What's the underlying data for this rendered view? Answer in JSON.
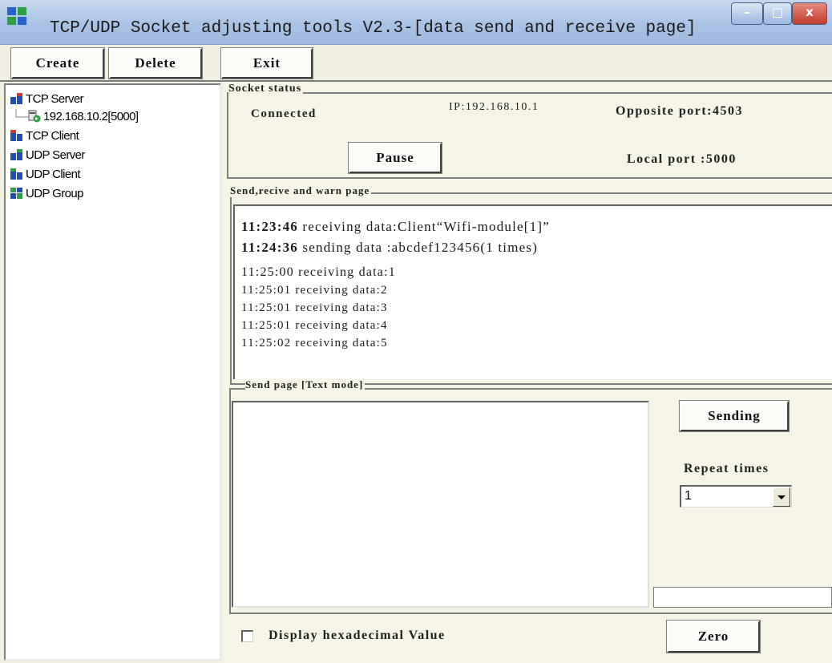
{
  "window": {
    "title": "TCP/UDP Socket adjusting tools V2.3-[data send and receive page]",
    "controls": {
      "minimize": "–",
      "maximize": "□",
      "close": "x"
    }
  },
  "toolbar": {
    "create": "Create",
    "delete": "Delete",
    "exit": "Exit"
  },
  "tree": {
    "items": [
      {
        "label": "TCP Server",
        "icon": "server-icon"
      },
      {
        "label": "192.168.10.2[5000]",
        "icon": "connection-icon"
      },
      {
        "label": "TCP Client",
        "icon": "client-icon"
      },
      {
        "label": "UDP Server",
        "icon": "server-icon"
      },
      {
        "label": "UDP Client",
        "icon": "client-icon"
      },
      {
        "label": "UDP Group",
        "icon": "group-icon"
      }
    ]
  },
  "socket_status": {
    "group_label": "Socket status",
    "state": "Connected",
    "ip": "IP:192.168.10.1",
    "opposite_port": "Opposite port:4503",
    "local_port": "Local port :5000",
    "pause_button": "Pause"
  },
  "log": {
    "group_label": "Send,recive and warn page",
    "lines": [
      {
        "time": "11:23:46",
        "text": " receiving data:Client“Wifi-module[1]”"
      },
      {
        "time": "11:24:36",
        "text": " sending data :abcdef123456(1 times)"
      },
      {
        "time": "",
        "text": "11:25:00 receiving data:1"
      },
      {
        "time": "",
        "text": "11:25:01 receiving data:2"
      },
      {
        "time": "",
        "text": "11:25:01 receiving data:3"
      },
      {
        "time": "",
        "text": "11:25:01 receiving data:4"
      },
      {
        "time": "",
        "text": "11:25:02 receiving data:5"
      }
    ]
  },
  "send": {
    "group_label": "Send page [Text mode]",
    "input_value": "",
    "sending_button": "Sending",
    "repeat_label": "Repeat times",
    "repeat_value": "1",
    "hex_checkbox_label": "Display hexadecimal Value",
    "hex_checked": false,
    "zero_button": "Zero"
  },
  "colors": {
    "titlebar": "#a9c3e6",
    "window_bg": "#f1efe2",
    "panel_bg": "#f6f4e6",
    "tree_icon_blue": "#1f4fb4",
    "tree_icon_green": "#2ea043",
    "tree_icon_red": "#d23a2a"
  }
}
